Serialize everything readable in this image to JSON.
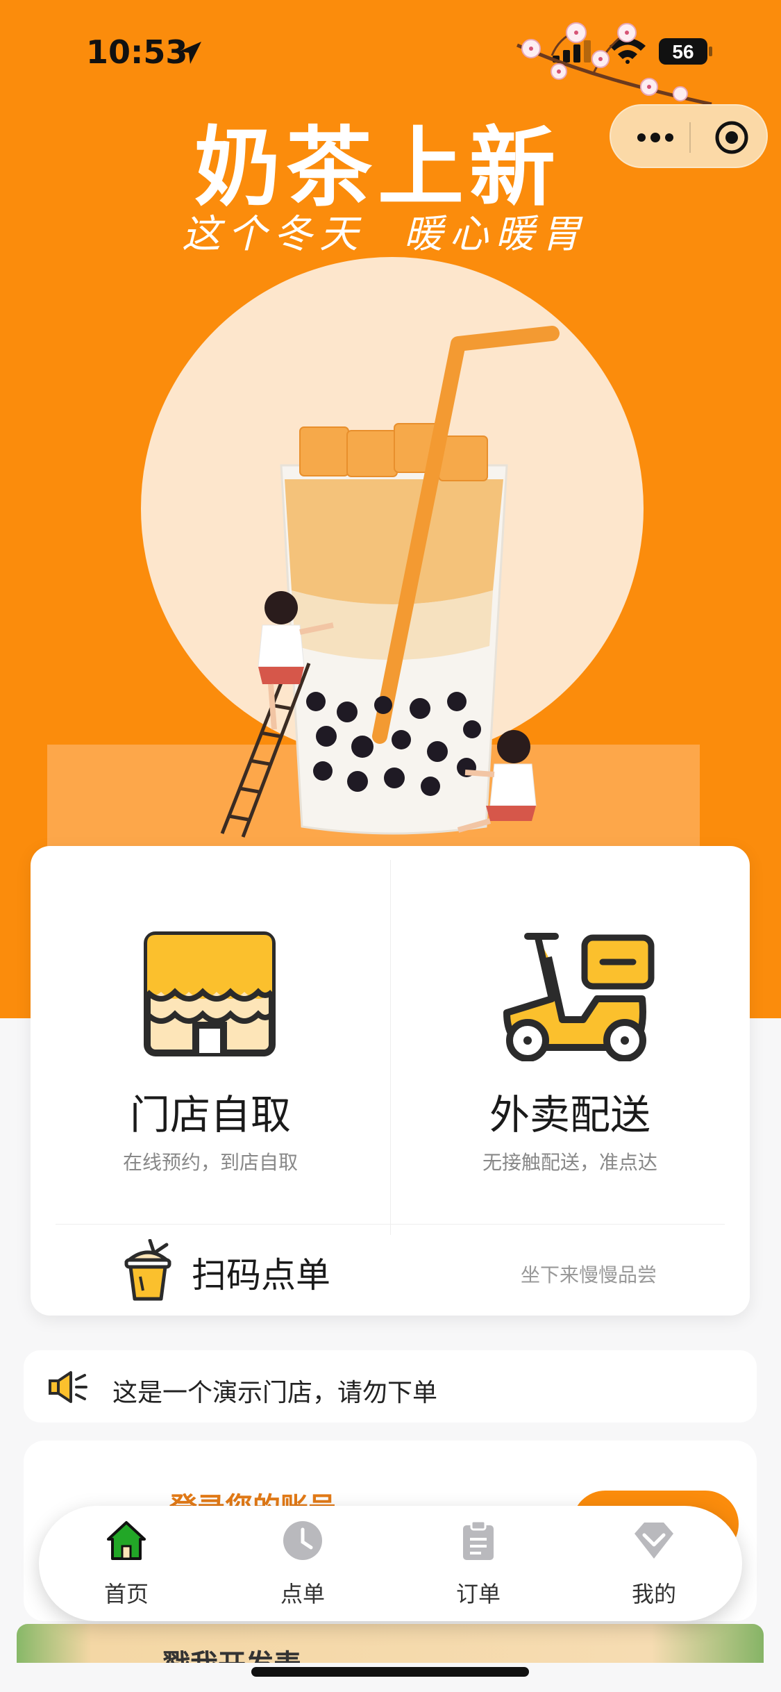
{
  "status_bar": {
    "time": "10:53",
    "battery": "56"
  },
  "hero": {
    "title": "奶茶上新",
    "subtitle": "这个冬天  暖心暖胃"
  },
  "card": {
    "pickup": {
      "title": "门店自取",
      "desc": "在线预约，到店自取"
    },
    "delivery": {
      "title": "外卖配送",
      "desc": "无接触配送，准点达"
    },
    "scan": {
      "title": "扫码点单",
      "subtitle": "坐下来慢慢品尝"
    }
  },
  "notice": {
    "text": "这是一个演示门店，请勿下单"
  },
  "login": {
    "text": "登录您的账号"
  },
  "tabs": [
    {
      "label": "首页",
      "icon": "home-icon",
      "active": true
    },
    {
      "label": "点单",
      "icon": "clock-icon",
      "active": false
    },
    {
      "label": "订单",
      "icon": "clipboard-icon",
      "active": false
    },
    {
      "label": "我的",
      "icon": "diamond-icon",
      "active": false
    }
  ],
  "banner": {
    "text": "戳我开发表"
  },
  "colors": {
    "brand": "#fb8c0c",
    "accent": "#fbc02d",
    "home_active": "#22a727"
  }
}
